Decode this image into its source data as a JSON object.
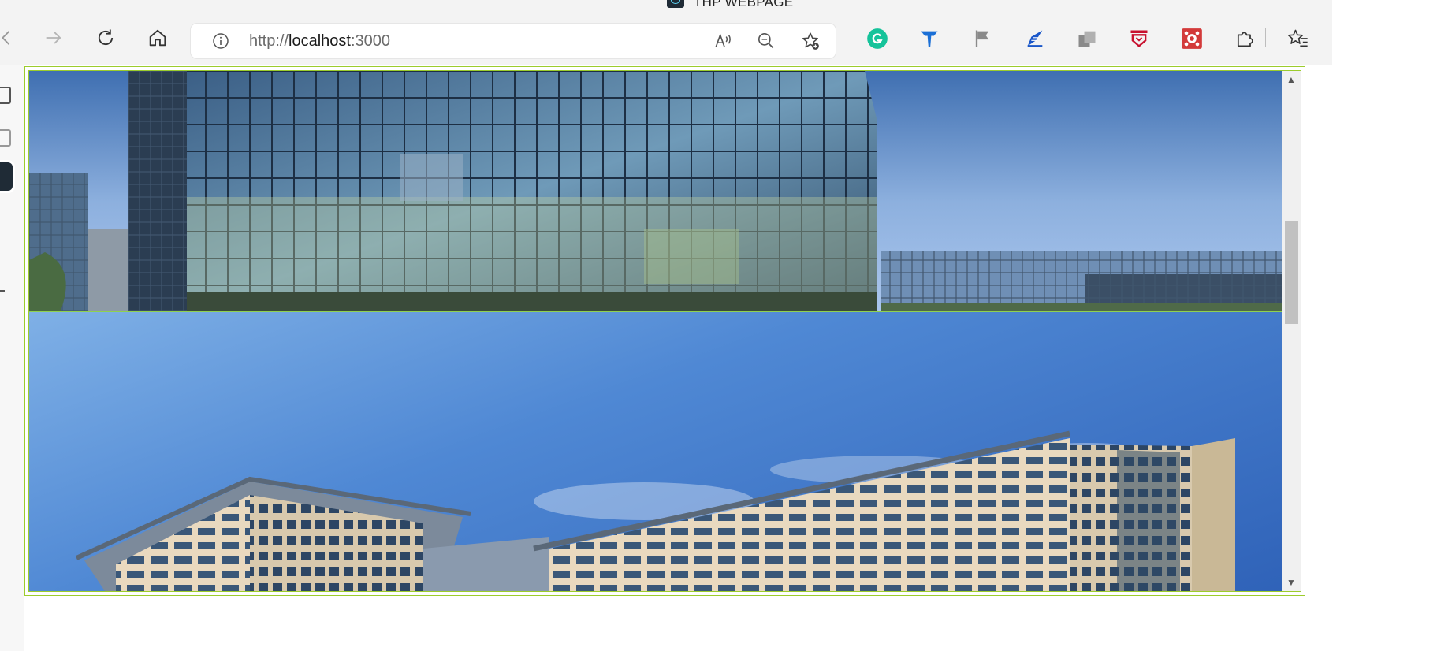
{
  "window": {
    "title": "THP WEBPAGE",
    "tab_icon": "react-icon"
  },
  "toolbar": {
    "buttons": [
      {
        "name": "back-button",
        "icon": "arrow-left-icon"
      },
      {
        "name": "forward-button",
        "icon": "arrow-right-icon",
        "state": "disabled"
      },
      {
        "name": "refresh-button",
        "icon": "refresh-icon"
      },
      {
        "name": "home-button",
        "icon": "home-icon"
      }
    ],
    "address_bar": {
      "protocol": "http://",
      "host": "localhost",
      "port": ":3000",
      "icons": [
        "info-icon",
        "read-aloud-icon",
        "zoom-out-icon",
        "add-favorite-icon"
      ]
    },
    "extensions": [
      {
        "name": "grammarly-extension",
        "color": "#15c39a"
      },
      {
        "name": "blue-tooth-extension",
        "color": "#1a6fd6"
      },
      {
        "name": "flag-extension",
        "color": "#8a8a8a"
      },
      {
        "name": "pen-extension",
        "color": "#1a57c9"
      },
      {
        "name": "copy-extension",
        "color": "#8a8a8a"
      },
      {
        "name": "mcafee-extension",
        "color": "#c8102e"
      },
      {
        "name": "red-app-extension",
        "color": "#d33a3a"
      },
      {
        "name": "extensions-puzzle",
        "color": "#333333"
      },
      {
        "name": "favorites-button",
        "color": "#333333"
      }
    ]
  },
  "page": {
    "frame_border_color": "#9ccc2c",
    "banners": [
      {
        "name": "banner-glass-office-tower",
        "description_icon": "building-image"
      },
      {
        "name": "banner-campus-building",
        "description_icon": "building-image"
      }
    ],
    "scrollbar": {
      "position": 0.29
    }
  }
}
